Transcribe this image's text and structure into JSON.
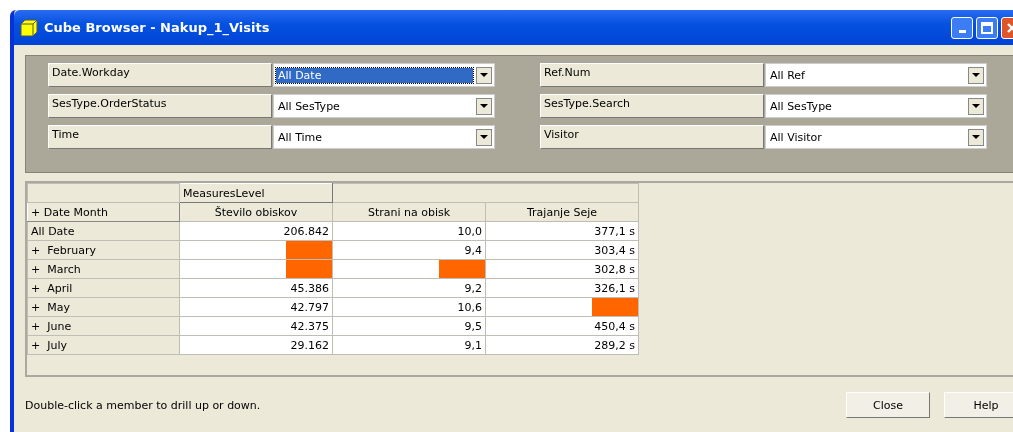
{
  "window": {
    "title": "Cube Browser - Nakup_1_Visits"
  },
  "filters": [
    {
      "label": "Date.Workday",
      "value": "All Date",
      "selected": true
    },
    {
      "label": "Ref.Num",
      "value": "All Ref",
      "selected": false
    },
    {
      "label": "SesType.OrderStatus",
      "value": "All SesType",
      "selected": false
    },
    {
      "label": "SesType.Search",
      "value": "All SesType",
      "selected": false
    },
    {
      "label": "Time",
      "value": "All Time",
      "selected": false
    },
    {
      "label": "Visitor",
      "value": "All Visitor",
      "selected": false
    }
  ],
  "table": {
    "measures_header": "MeasuresLevel",
    "row_header": "+ Date Month",
    "columns": [
      "Število obiskov",
      "Strani na obisk",
      "Trajanje Seje"
    ],
    "rows": [
      {
        "label": "All Date",
        "cells": [
          {
            "value": "206.842",
            "redacted": false
          },
          {
            "value": "10,0",
            "redacted": false
          },
          {
            "value": "377,1 s",
            "redacted": false
          }
        ]
      },
      {
        "label": "+  February",
        "cells": [
          {
            "redacted": true
          },
          {
            "value": "9,4",
            "redacted": false
          },
          {
            "value": "303,4 s",
            "redacted": false
          }
        ]
      },
      {
        "label": "+  March",
        "cells": [
          {
            "redacted": true
          },
          {
            "redacted": true
          },
          {
            "value": "302,8 s",
            "redacted": false
          }
        ]
      },
      {
        "label": "+  April",
        "cells": [
          {
            "value": "45.386",
            "redacted": false
          },
          {
            "value": "9,2",
            "redacted": false
          },
          {
            "value": "326,1 s",
            "redacted": false
          }
        ]
      },
      {
        "label": "+  May",
        "cells": [
          {
            "value": "42.797",
            "redacted": false
          },
          {
            "value": "10,6",
            "redacted": false
          },
          {
            "redacted": true
          }
        ]
      },
      {
        "label": "+  June",
        "cells": [
          {
            "value": "42.375",
            "redacted": false
          },
          {
            "value": "9,5",
            "redacted": false
          },
          {
            "value": "450,4 s",
            "redacted": false
          }
        ]
      },
      {
        "label": "+  July",
        "cells": [
          {
            "value": "29.162",
            "redacted": false
          },
          {
            "value": "9,1",
            "redacted": false
          },
          {
            "value": "289,2 s",
            "redacted": false
          }
        ]
      }
    ]
  },
  "status_bar": {
    "text": "Double-click a member to drill up or down."
  },
  "buttons": [
    "Close",
    "Help"
  ]
}
